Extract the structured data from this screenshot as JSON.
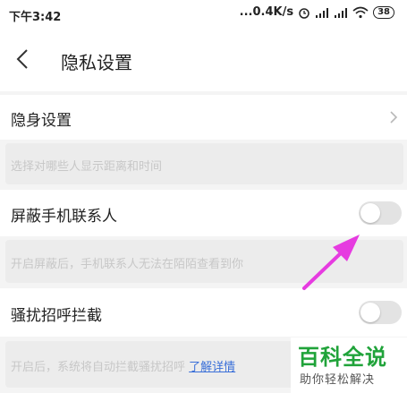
{
  "status_bar": {
    "time": "下午3:42",
    "network_speed": "...0.4K/s",
    "battery_level": "38",
    "icons": [
      "alarm-icon",
      "signal-hd-icon",
      "signal-icon",
      "wifi-icon",
      "battery-icon"
    ]
  },
  "header": {
    "back_icon": "chevron-left-icon",
    "title": "隐私设置"
  },
  "settings": {
    "invisible": {
      "label": "隐身设置",
      "hint": "选择对哪些人显示距离和时间"
    },
    "block_contacts": {
      "label": "屏蔽手机联系人",
      "hint": "开启屏蔽后，手机联系人无法在陌陌查看到你",
      "enabled": false
    },
    "harass_block": {
      "label": "骚扰招呼拦截",
      "hint": "开启后，系统将自动拦截骚扰招呼",
      "link": "了解详情",
      "enabled": false
    }
  },
  "annotation": {
    "color": "#e63be0"
  },
  "watermark": {
    "title": "百科全说",
    "subtitle": "助你轻松解决"
  },
  "colors": {
    "accent_link": "#3a6fd8",
    "watermark_green": "#20a33a"
  }
}
